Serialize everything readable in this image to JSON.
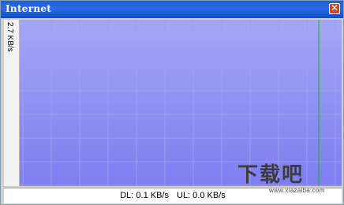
{
  "window": {
    "title": "Internet",
    "close_icon": "close-icon",
    "accent_color": "#1e5fd8"
  },
  "graph": {
    "scale_label": "2.7 KB/s",
    "background_color": "#8f8ff2",
    "grid_color": "#9e9ef2",
    "download_color": "#00c000"
  },
  "status": {
    "dl": "DL: 0.1 KB/s",
    "ul": "UL: 0.0 KB/s"
  },
  "watermark": {
    "logo": "下载吧",
    "url": "www.xiazaiba.com"
  }
}
